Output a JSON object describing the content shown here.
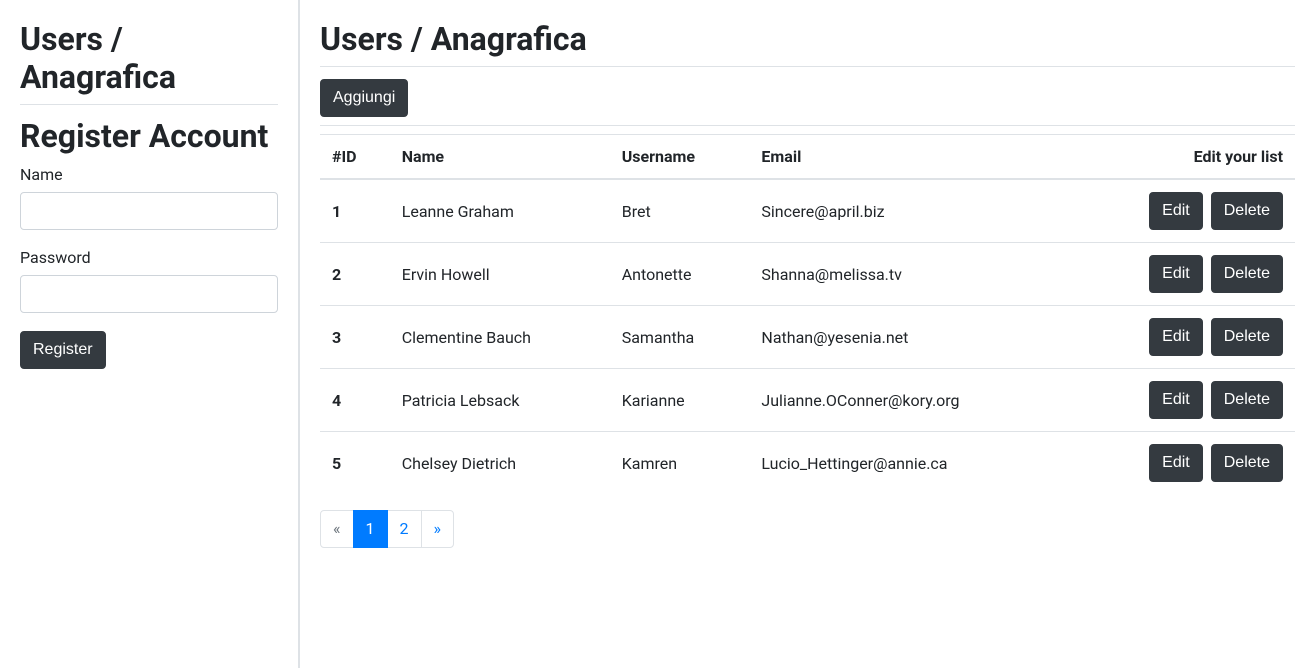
{
  "sidebar": {
    "title": "Users / Anagrafica",
    "register_title": "Register Account",
    "name_label": "Name",
    "password_label": "Password",
    "register_button": "Register"
  },
  "main": {
    "title": "Users / Anagrafica",
    "add_button": "Aggiungi",
    "table": {
      "columns": {
        "id": "#ID",
        "name": "Name",
        "username": "Username",
        "email": "Email",
        "actions": "Edit your list"
      },
      "rows": [
        {
          "id": "1",
          "name": "Leanne Graham",
          "username": "Bret",
          "email": "Sincere@april.biz"
        },
        {
          "id": "2",
          "name": "Ervin Howell",
          "username": "Antonette",
          "email": "Shanna@melissa.tv"
        },
        {
          "id": "3",
          "name": "Clementine Bauch",
          "username": "Samantha",
          "email": "Nathan@yesenia.net"
        },
        {
          "id": "4",
          "name": "Patricia Lebsack",
          "username": "Karianne",
          "email": "Julianne.OConner@kory.org"
        },
        {
          "id": "5",
          "name": "Chelsey Dietrich",
          "username": "Kamren",
          "email": "Lucio_Hettinger@annie.ca"
        }
      ],
      "edit_label": "Edit",
      "delete_label": "Delete"
    },
    "pagination": {
      "prev": "«",
      "next": "»",
      "pages": [
        "1",
        "2"
      ],
      "active_index": 0
    }
  }
}
